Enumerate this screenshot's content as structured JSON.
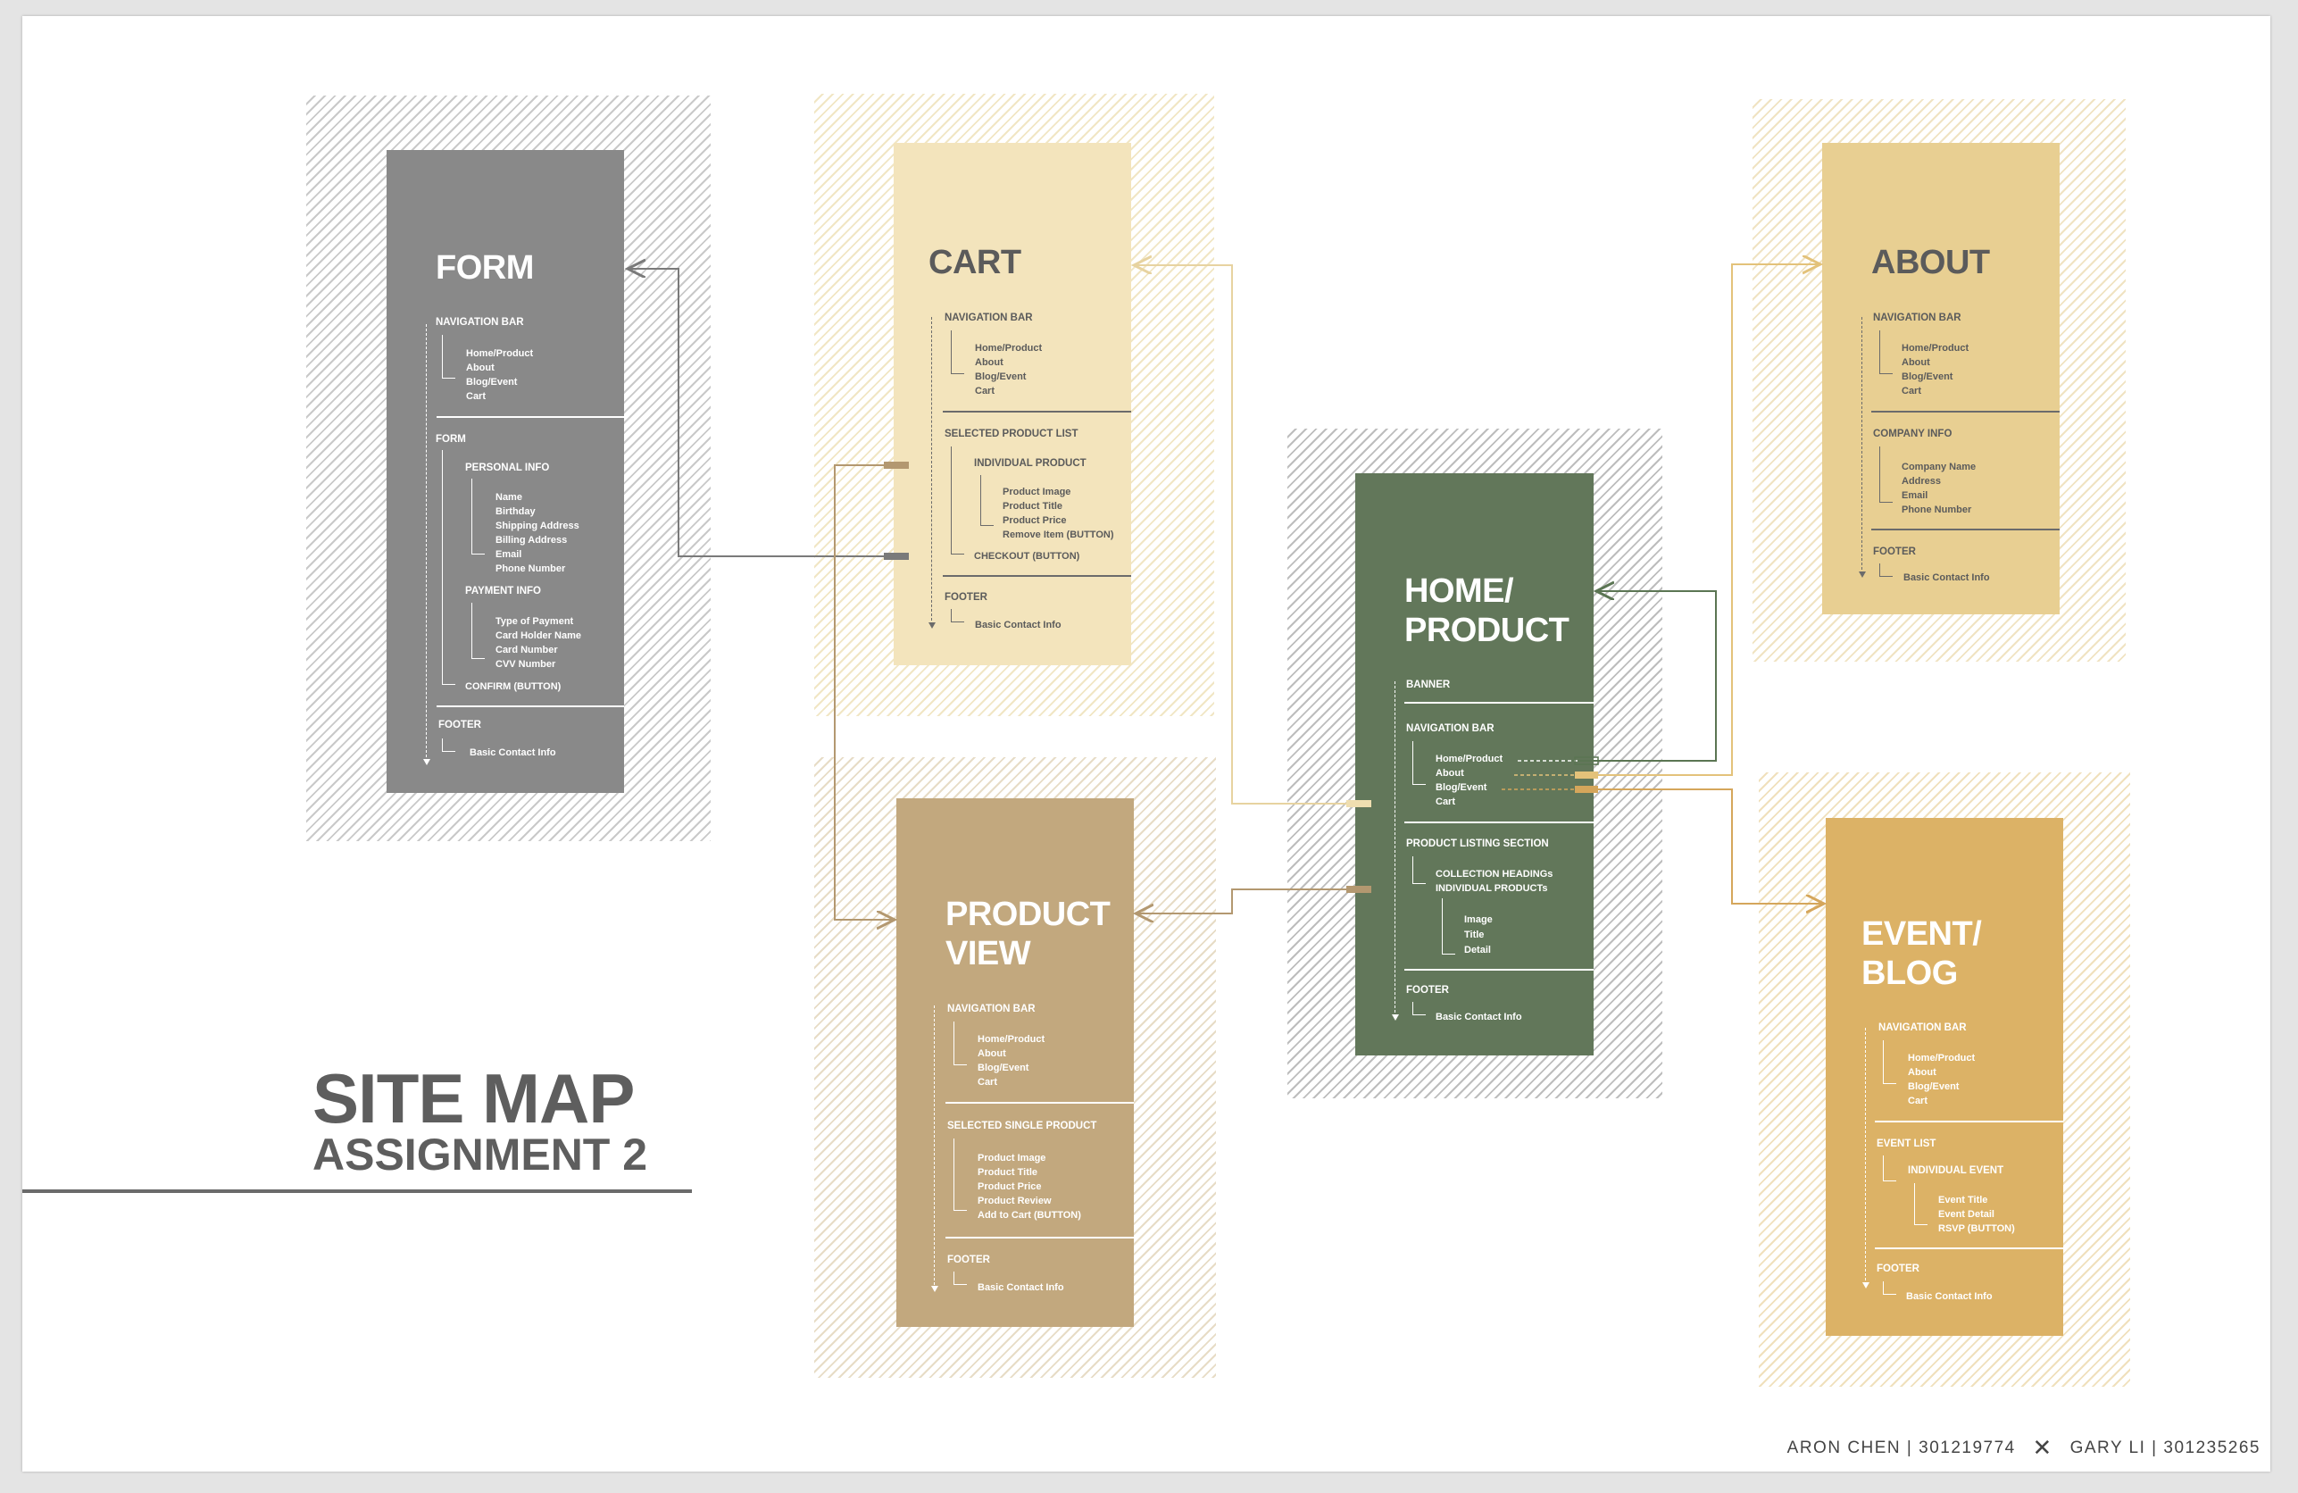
{
  "title": "SITE MAP",
  "subtitle": "ASSIGNMENT 2",
  "credits": {
    "author1": "ARON CHEN | 301219774",
    "separator": "✕",
    "author2": "GARY LI | 301235265"
  },
  "colors": {
    "form": "#898989",
    "cart": "#f3e4bc",
    "product_view": "#c2a87e",
    "home": "#62775a",
    "about": "#e8cf92",
    "event": "#dcb266"
  },
  "cards": {
    "form": {
      "title": "FORM",
      "nav": {
        "label": "NAVIGATION BAR",
        "items": [
          "Home/Product",
          "About",
          "Blog/Event",
          "Cart"
        ]
      },
      "form_label": "FORM",
      "personal": {
        "label": "PERSONAL INFO",
        "items": [
          "Name",
          "Birthday",
          "Shipping Address",
          "Billing Address",
          "Email",
          "Phone Number"
        ]
      },
      "payment": {
        "label": "PAYMENT INFO",
        "items": [
          "Type of Payment",
          "Card Holder Name",
          "Card Number",
          "CVV Number"
        ]
      },
      "confirm": "CONFIRM (BUTTON)",
      "footer": {
        "label": "FOOTER",
        "items": [
          "Basic Contact Info"
        ]
      }
    },
    "cart": {
      "title": "CART",
      "nav": {
        "label": "NAVIGATION BAR",
        "items": [
          "Home/Product",
          "About",
          "Blog/Event",
          "Cart"
        ]
      },
      "list_label": "SELECTED PRODUCT LIST",
      "individual": {
        "label": "INDIVIDUAL PRODUCT",
        "items": [
          "Product Image",
          "Product Title",
          "Product Price",
          "Remove Item (BUTTON)"
        ]
      },
      "checkout": "CHECKOUT (BUTTON)",
      "footer": {
        "label": "FOOTER",
        "items": [
          "Basic Contact Info"
        ]
      }
    },
    "product_view": {
      "title": "PRODUCT\nVIEW",
      "nav": {
        "label": "NAVIGATION BAR",
        "items": [
          "Home/Product",
          "About",
          "Blog/Event",
          "Cart"
        ]
      },
      "selected": {
        "label": "SELECTED SINGLE PRODUCT",
        "items": [
          "Product Image",
          "Product Title",
          "Product Price",
          "Product Review",
          "Add to Cart (BUTTON)"
        ]
      },
      "footer": {
        "label": "FOOTER",
        "items": [
          "Basic Contact Info"
        ]
      }
    },
    "home": {
      "title": "HOME/\nPRODUCT",
      "banner": "BANNER",
      "nav": {
        "label": "NAVIGATION BAR",
        "items": [
          "Home/Product",
          "About",
          "Blog/Event",
          "Cart"
        ]
      },
      "listing": {
        "label": "PRODUCT LISTING SECTION",
        "items": [
          "COLLECTION HEADINGs",
          "INDIVIDUAL PRODUCTs"
        ]
      },
      "product_items": [
        "Image",
        "Title",
        "Detail"
      ],
      "footer": {
        "label": "FOOTER",
        "items": [
          "Basic Contact Info"
        ]
      }
    },
    "about": {
      "title": "ABOUT",
      "nav": {
        "label": "NAVIGATION BAR",
        "items": [
          "Home/Product",
          "About",
          "Blog/Event",
          "Cart"
        ]
      },
      "company": {
        "label": "COMPANY INFO",
        "items": [
          "Company Name",
          "Address",
          "Email",
          "Phone Number"
        ]
      },
      "footer": {
        "label": "FOOTER",
        "items": [
          "Basic Contact Info"
        ]
      }
    },
    "event": {
      "title": "EVENT/\nBLOG",
      "nav": {
        "label": "NAVIGATION BAR",
        "items": [
          "Home/Product",
          "About",
          "Blog/Event",
          "Cart"
        ]
      },
      "list_label": "EVENT LIST",
      "individual": {
        "label": "INDIVIDUAL EVENT",
        "items": [
          "Event Title",
          "Event Detail",
          "RSVP (BUTTON)"
        ]
      },
      "footer": {
        "label": "FOOTER",
        "items": [
          "Basic Contact Info"
        ]
      }
    }
  }
}
